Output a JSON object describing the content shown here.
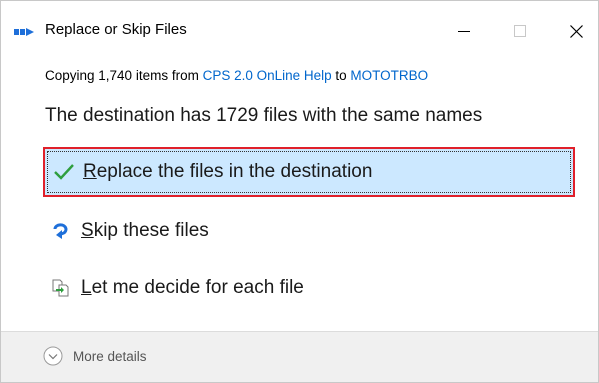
{
  "window": {
    "title": "Replace or Skip Files",
    "controls": {
      "minimize": "minimize",
      "maximize": "maximize",
      "close": "close"
    }
  },
  "copy_info": {
    "prefix": "Copying 1,740 items from ",
    "source": "CPS 2.0 OnLine Help",
    "middle": " to ",
    "destination": "MOTOTRBO"
  },
  "headline": "The destination has 1729 files with the same names",
  "options": [
    {
      "icon": "checkmark-icon",
      "hotkey": "R",
      "rest": "eplace the files in the destination",
      "selected": true
    },
    {
      "icon": "skip-arrow-icon",
      "hotkey": "S",
      "rest": "kip these files",
      "selected": false
    },
    {
      "icon": "compare-files-icon",
      "hotkey": "L",
      "rest": "et me decide for each file",
      "selected": false
    }
  ],
  "footer": {
    "more_details": "More details",
    "icon": "chevron-down-circle-icon"
  },
  "colors": {
    "selected_bg": "#cce8ff",
    "highlight_border": "#e0202a",
    "link": "#0066cc",
    "check": "#2e9e3e",
    "skip_arrow": "#1e6fd9"
  }
}
